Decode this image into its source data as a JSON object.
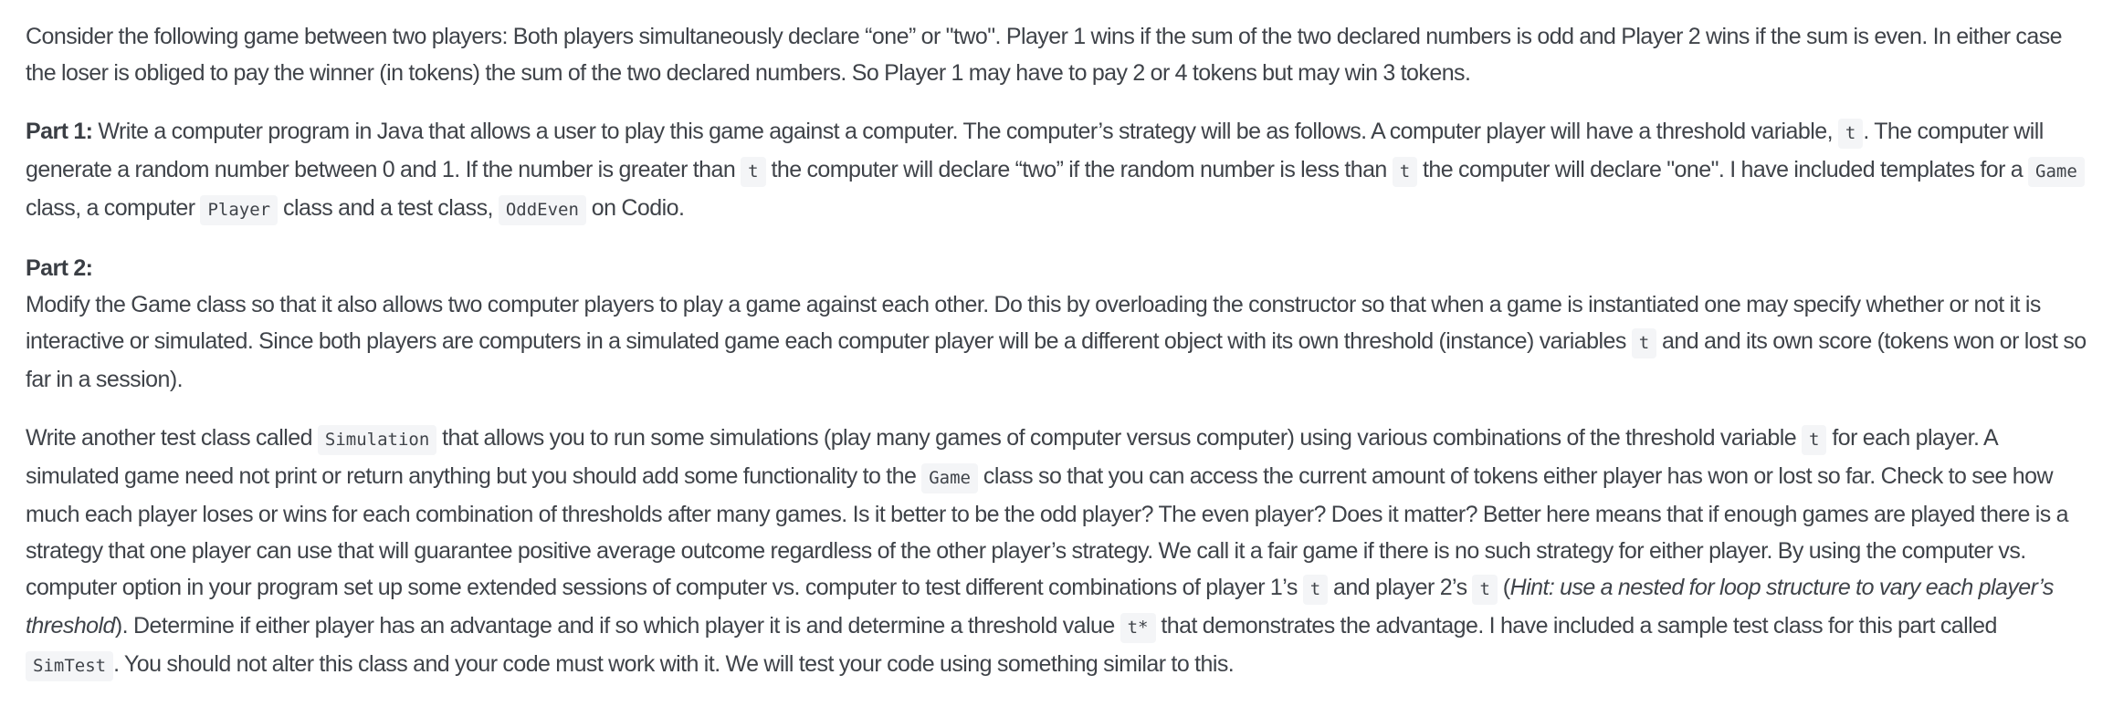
{
  "intro": {
    "text": "Consider the following game between two players: Both players simultaneously declare “one” or \"two\". Player 1 wins if the sum of the two declared numbers is odd and Player 2 wins if the sum is even. In either case the loser is obliged to pay the winner (in tokens) the sum of the two declared numbers. So Player 1 may have to pay 2 or 4 tokens but may win 3 tokens."
  },
  "part1": {
    "heading": "Part 1:",
    "s1": " Write a computer program in Java that allows a user to play this game against a computer. The computer’s strategy will be as follows. A computer player will have a threshold variable, ",
    "code1": "t",
    "s2": ". The computer will generate a random number between 0 and 1. If the number is greater than ",
    "code2": "t",
    "s3": " the computer will declare “two” if the random number is less than ",
    "code3": "t",
    "s4": " the computer will declare \"one\". I have included templates for a ",
    "code4": "Game",
    "s5": " class, a computer ",
    "code5": "Player",
    "s6": " class and a test class, ",
    "code6": "OddEven",
    "s7": " on Codio."
  },
  "part2": {
    "heading": "Part 2:",
    "s1": "Modify the Game class so that it also allows two computer players to play a game against each other. Do this by overloading the constructor so that when a game is instantiated one may specify whether or not it is interactive or simulated. Since both players are computers in a simulated game each computer player will be a different object with its own threshold (instance) variables ",
    "code1": "t",
    "s2": " and and its own score (tokens won or lost so far in a session)."
  },
  "simulation": {
    "s1": "Write another test class called ",
    "code1": "Simulation",
    "s2": " that allows you to run some simulations (play many games of computer versus computer) using various combinations of the threshold variable ",
    "code2": "t",
    "s3": " for each player. A simulated game need not print or return anything but you should add some functionality to the ",
    "code3": "Game",
    "s4": " class so that you can access the current amount of tokens either player has won or lost so far. Check to see how much each player loses or wins for each combination of thresholds after many games. Is it better to be the odd player? The even player? Does it matter? Better here means that if enough games are played there is a strategy that one player can use that will guarantee positive average outcome regardless of the other player’s strategy. We call it a fair game if there is no such strategy for either player. By using the computer vs. computer option in your program set up some extended sessions of computer vs. computer to test different combinations of player 1’s ",
    "code4": "t",
    "s5": " and player 2’s ",
    "code5": "t",
    "s6": " (",
    "hint": "Hint: use a nested for loop structure to vary each player’s threshold",
    "s7": "). Determine if either player has an advantage and if so which player it is and determine a threshold value ",
    "code6": "t*",
    "s8": " that demonstrates the advantage. I have included a sample test class for this part called ",
    "code7": "SimTest",
    "s9": ". You should not alter this class and your code must work with it. We will test your code using something similar to this."
  }
}
